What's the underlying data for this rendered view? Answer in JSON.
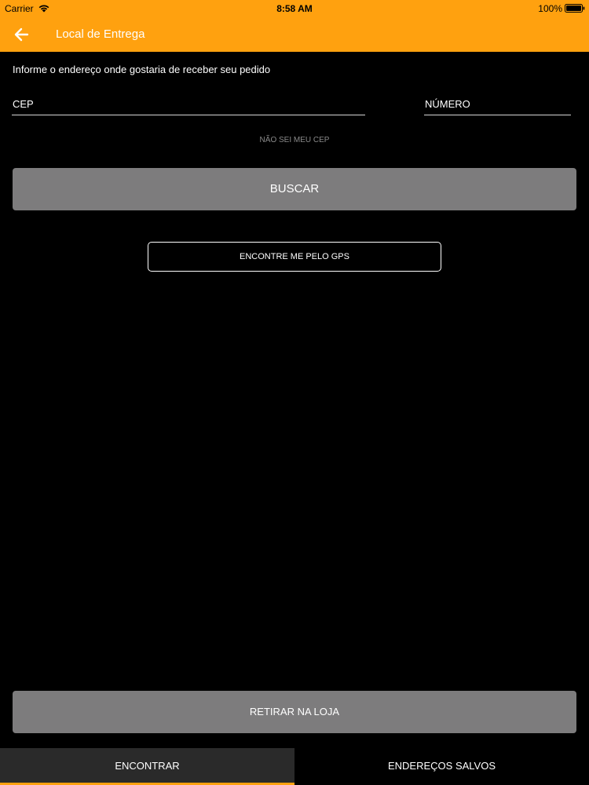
{
  "status_bar": {
    "carrier": "Carrier",
    "time": "8:58 AM",
    "battery": "100%"
  },
  "app_bar": {
    "title": "Local de Entrega",
    "background_color": "#FFA10F",
    "back_icon": "arrow-left-icon"
  },
  "form": {
    "instruction": "Informe o endereço onde gostaria de receber seu pedido",
    "cep": {
      "placeholder": "CEP",
      "value": ""
    },
    "numero": {
      "placeholder": "NÚMERO",
      "value": ""
    },
    "dont_know_cep": "NÃO SEI MEU CEP",
    "search_label": "BUSCAR",
    "gps_label": "ENCONTRE ME PELO GPS"
  },
  "pickup_label": "RETIRAR NA LOJA",
  "tabs": [
    {
      "label": "ENCONTRAR",
      "active": true
    },
    {
      "label": "ENDEREÇOS SALVOS",
      "active": false
    }
  ],
  "colors": {
    "accent": "#FFA10F",
    "button_gray": "#7d7c7d",
    "background": "#000000"
  }
}
